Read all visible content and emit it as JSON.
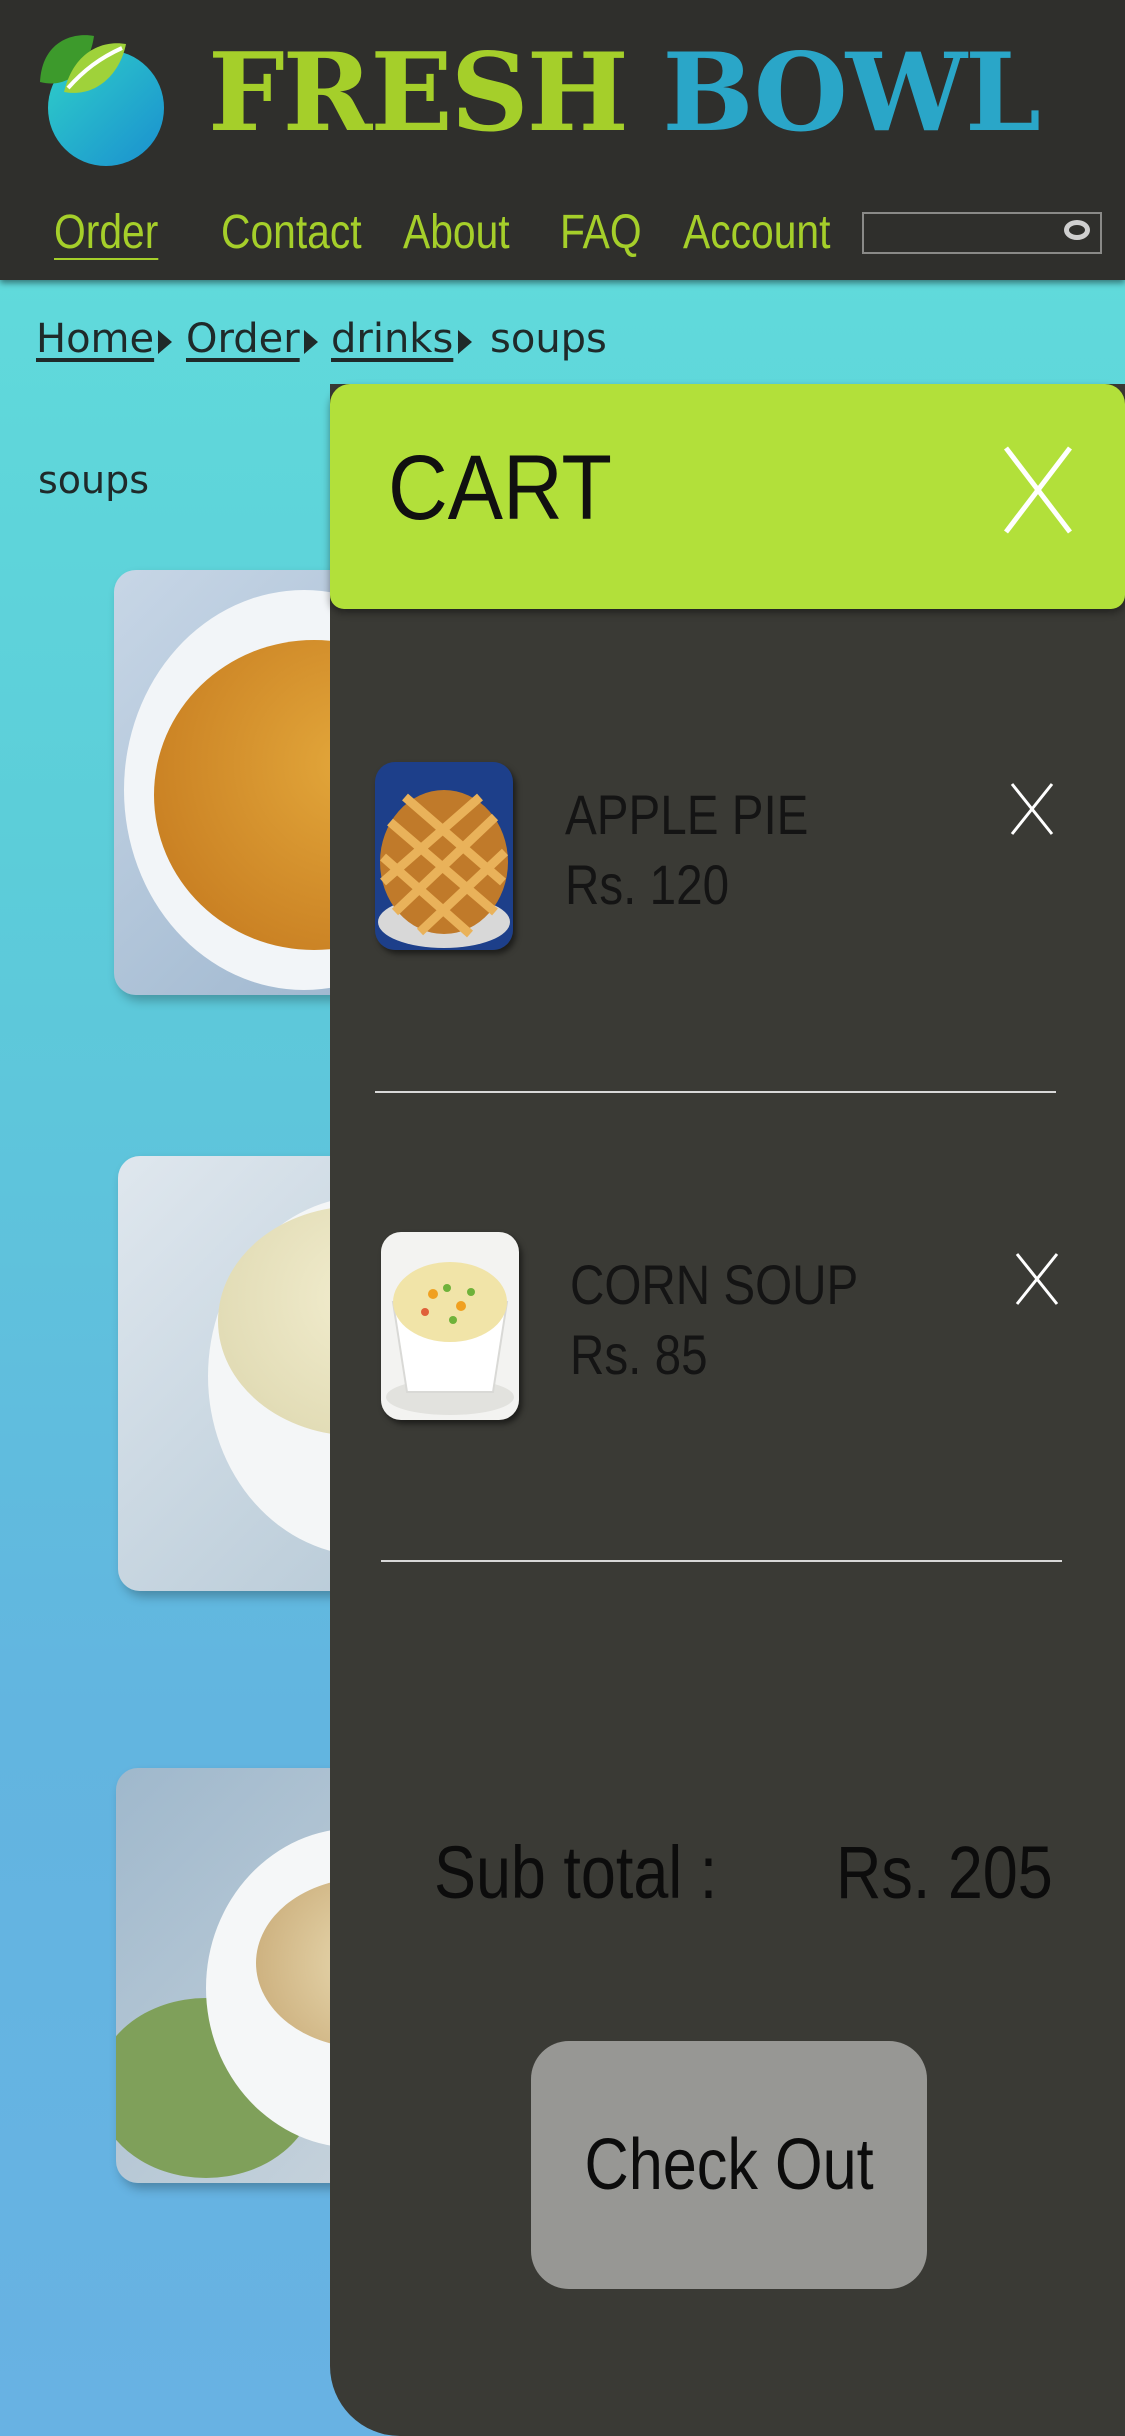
{
  "brand": {
    "word1": "FRESH",
    "word2": "BOWL"
  },
  "nav": {
    "items": [
      "Order",
      "Contact",
      "About",
      "FAQ",
      "Account"
    ],
    "active": "Order"
  },
  "search": {
    "placeholder": ""
  },
  "breadcrumb": [
    "Home",
    "Order",
    "drinks",
    "soups"
  ],
  "section_title": "soups",
  "cart": {
    "title": "CART",
    "items": [
      {
        "name": "APPLE  PIE",
        "price": "Rs. 120"
      },
      {
        "name": "CORN SOUP",
        "price": "Rs. 85"
      }
    ],
    "subtotal_label": "Sub total :",
    "subtotal_value": "Rs. 205",
    "checkout_label": "Check Out"
  },
  "colors": {
    "header_bg": "#2f2f2c",
    "brand_green": "#a5cf2a",
    "brand_blue": "#2aa6c8",
    "cart_bg": "#3a3a35",
    "cart_header": "#b2e03a",
    "checkout_button": "#979794"
  },
  "icons": [
    "logo-leaf-icon",
    "search-icon",
    "close-icon",
    "chevron-right-icon"
  ]
}
